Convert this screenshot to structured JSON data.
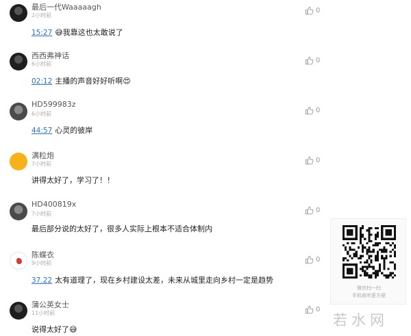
{
  "comments": [
    {
      "name": "最后一代Waaaaagh",
      "time": "2小时前",
      "stamp": "15:27",
      "text": "😅我靠这也太敢说了",
      "likes": "0"
    },
    {
      "name": "西西弗神话",
      "time": "6小时前",
      "stamp": "02:12",
      "text": "主播的声音好好听啊😍",
      "likes": "0"
    },
    {
      "name": "HD599983z",
      "time": "6小时前",
      "stamp": "44:57",
      "text": "心灵的彼岸",
      "likes": "0"
    },
    {
      "name": "满粒炮",
      "time": "7小时前",
      "stamp": "",
      "text": "讲得太好了，学习了！！",
      "likes": "0"
    },
    {
      "name": "HD400819x",
      "time": "7小时前",
      "stamp": "",
      "text": "最后部分说的太好了，很多人实际上根本不适合体制内",
      "likes": "0"
    },
    {
      "name": "陈蝶衣",
      "time": "9小时前",
      "stamp": "37.22",
      "text": "太有道理了，现在乡村建设太差，未来从城里走向乡村一定是趋势",
      "likes": "0"
    },
    {
      "name": "蒲公英女士",
      "time": "11小时前",
      "stamp": "",
      "text": "说得太好了😅",
      "likes": "0"
    }
  ],
  "qr": {
    "caption1": "微信扫一扫",
    "caption2": "手机收听更方便"
  },
  "watermark": "若水网",
  "icons": {
    "like": "thumbs-up-icon",
    "qr": "qr-code-icon"
  },
  "colors": {
    "timestamp_link": "#2f6fbf",
    "meta": "#aaaaaa",
    "avatar_yellow": "#f6b21b"
  }
}
